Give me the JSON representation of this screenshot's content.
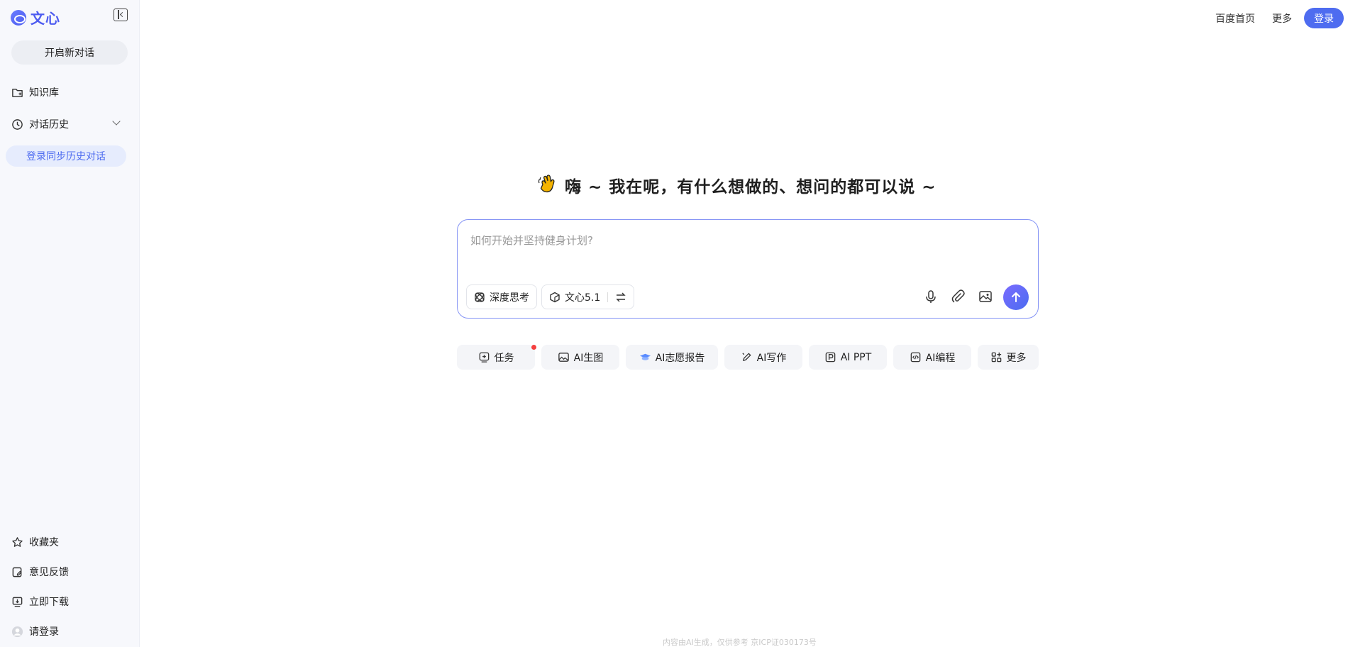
{
  "sidebar": {
    "logo_text": "文心",
    "new_chat": "开启新对话",
    "knowledge": "知识库",
    "history": "对话历史",
    "login_sync": "登录同步历史对话",
    "favorites": "收藏夹",
    "feedback": "意见反馈",
    "download": "立即下载",
    "login": "请登录"
  },
  "header": {
    "baidu_home": "百度首页",
    "more": "更多",
    "login": "登录"
  },
  "main": {
    "greeting": "嗨 ~ 我在呢，有什么想做的、想问的都可以说 ~",
    "input_placeholder": "如何开始并坚持健身计划?",
    "deep_think": "深度思考",
    "model_name": "文心5.1",
    "quick_actions": [
      {
        "label": "任务"
      },
      {
        "label": "AI生图"
      },
      {
        "label": "AI志愿报告"
      },
      {
        "label": "AI写作"
      },
      {
        "label": "AI PPT"
      },
      {
        "label": "AI编程"
      },
      {
        "label": "更多"
      }
    ]
  },
  "footer": {
    "note": "内容由AI生成，仅供参考  京ICP证030173号"
  },
  "colors": {
    "accent": "#4e6cf0",
    "sidebar_bg": "#f7f8fc",
    "notification": "#f53f3f"
  }
}
